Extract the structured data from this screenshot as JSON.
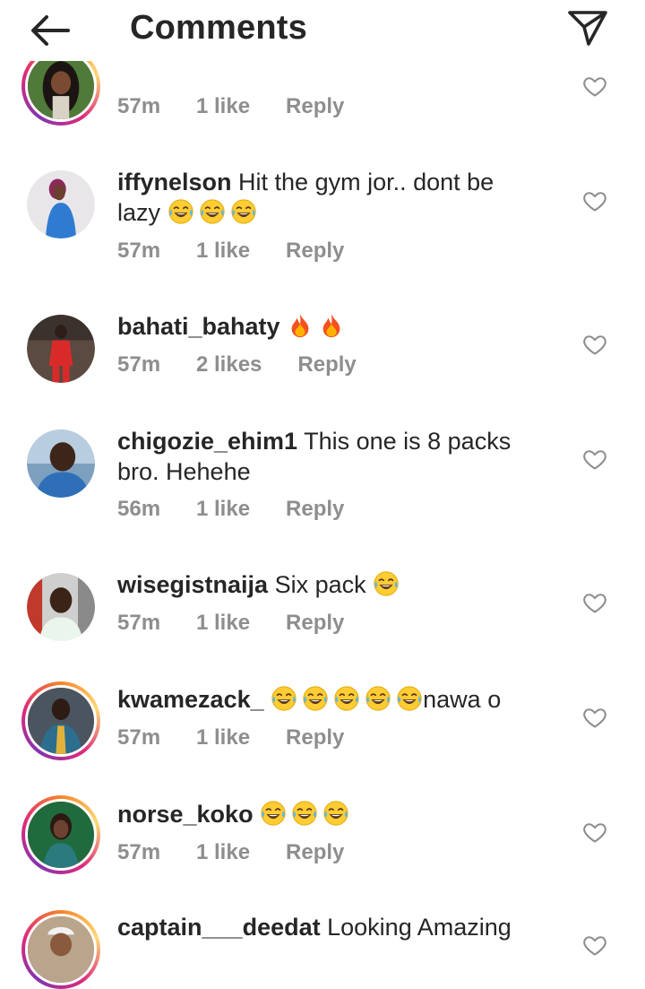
{
  "header": {
    "title": "Comments",
    "back_icon": "arrow-left-icon",
    "share_icon": "paper-plane-icon"
  },
  "colors": {
    "text": "#262626",
    "meta": "#8e8e8e",
    "story_ring": [
      "#f58529",
      "#dd2a7b",
      "#8134af"
    ]
  },
  "comments": [
    {
      "username": "",
      "text": "",
      "time": "57m",
      "likes": "1 like",
      "reply": "Reply",
      "avatar": "woman-dark-hair",
      "story_ring": true
    },
    {
      "username": "iffynelson",
      "text": "Hit the gym jor.. dont be lazy",
      "emojis": 3,
      "emoji_name": "tears-of-joy",
      "time": "57m",
      "likes": "1 like",
      "reply": "Reply",
      "avatar": "woman-blue-dress",
      "story_ring": false
    },
    {
      "username": "bahati_bahaty",
      "text": "",
      "emojis": 2,
      "emoji_name": "fire",
      "time": "57m",
      "likes": "2 likes",
      "reply": "Reply",
      "avatar": "man-red-outfit",
      "story_ring": false
    },
    {
      "username": "chigozie_ehim1",
      "text": "This one is 8 packs bro. Hehehe",
      "time": "56m",
      "likes": "1 like",
      "reply": "Reply",
      "avatar": "man-blue-shirt",
      "story_ring": false
    },
    {
      "username": "wisegistnaija",
      "text": "Six pack",
      "emojis": 1,
      "emoji_name": "tears-of-joy",
      "time": "57m",
      "likes": "1 like",
      "reply": "Reply",
      "avatar": "man-white-shirt",
      "story_ring": false
    },
    {
      "username": "kwamezack_",
      "text": "nawa o",
      "emojis": 5,
      "emoji_name": "tears-of-joy",
      "time": "57m",
      "likes": "1 like",
      "reply": "Reply",
      "avatar": "man-patterned-shirt",
      "story_ring": true
    },
    {
      "username": "norse_koko",
      "text": "",
      "emojis": 3,
      "emoji_name": "tears-of-joy",
      "time": "57m",
      "likes": "1 like",
      "reply": "Reply",
      "avatar": "woman-green-background",
      "story_ring": true
    },
    {
      "username": "captain___deedat",
      "text": "Looking Amazing",
      "avatar": "man-white-cap",
      "story_ring": true
    }
  ]
}
